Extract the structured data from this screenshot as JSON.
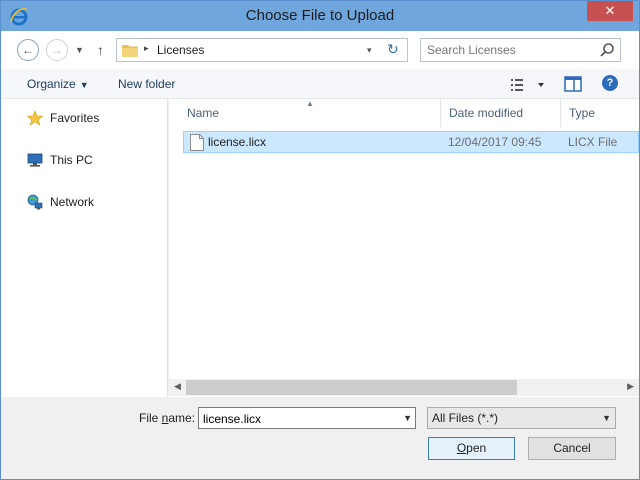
{
  "window": {
    "title": "Choose File to Upload",
    "close_label": "✕"
  },
  "nav": {
    "back_glyph": "←",
    "forward_glyph": "→",
    "recent_glyph": "▼",
    "up_glyph": "↑",
    "address_separator": "▸",
    "path": "Licenses",
    "address_dropdown_glyph": "▾",
    "refresh_glyph": "↻"
  },
  "search": {
    "placeholder": "Search Licenses"
  },
  "toolbar": {
    "organize_label": "Organize",
    "organize_caret": "▼",
    "new_folder_label": "New folder",
    "help_label": "?"
  },
  "sidebar": {
    "items": [
      {
        "label": "Favorites",
        "icon": "star-icon"
      },
      {
        "label": "This PC",
        "icon": "computer-icon"
      },
      {
        "label": "Network",
        "icon": "network-icon"
      }
    ]
  },
  "columns": {
    "name": "Name",
    "date": "Date modified",
    "type": "Type",
    "sort_glyph": "▲"
  },
  "files": [
    {
      "name": "license.licx",
      "date": "12/04/2017 09:45",
      "type": "LICX File"
    }
  ],
  "scrollbar": {
    "left_glyph": "◀",
    "right_glyph": "▶"
  },
  "footer": {
    "file_name_label_pre": "File ",
    "file_name_label_underline": "n",
    "file_name_label_post": "ame:",
    "file_name_value": "license.licx",
    "dropdown_glyph": "▼",
    "filter_value": "All Files (*.*)",
    "open_underline": "O",
    "open_rest": "pen",
    "cancel_label": "Cancel"
  },
  "colors": {
    "titlebar": "#6fa6dd",
    "selection": "#cce8ff",
    "close": "#c75050"
  }
}
